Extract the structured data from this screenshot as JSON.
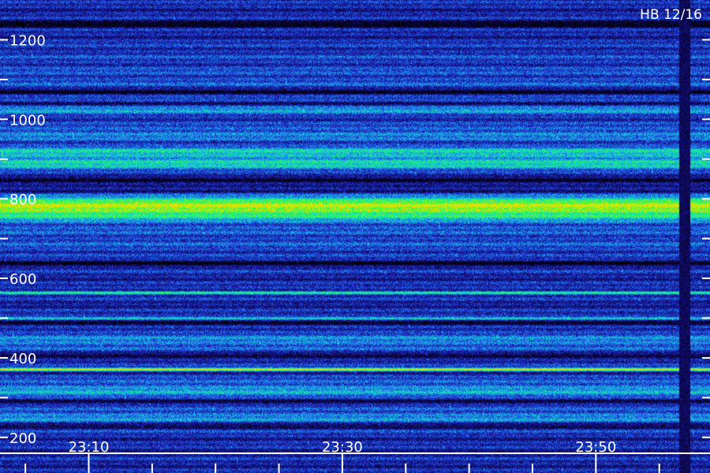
{
  "station_label": "HB 12/16",
  "chart_data": {
    "type": "heatmap",
    "title": "",
    "xlabel": "",
    "ylabel": "",
    "y_range": [
      160,
      1300
    ],
    "y_ticks_major": [
      200,
      400,
      600,
      800,
      1000,
      1200
    ],
    "y_tick_labels": [
      "200",
      "400",
      "600",
      "800",
      "1000",
      "1200"
    ],
    "y_ticks_minor": [
      300,
      500,
      700,
      900,
      1100
    ],
    "x_range": [
      "23:03",
      "23:59"
    ],
    "x_ticks_major": [
      "23:10",
      "23:30",
      "23:50"
    ],
    "x_tick_labels": [
      "23:10",
      "23:30",
      "23:50"
    ],
    "x_ticks_minor": [
      "23:05",
      "23:15",
      "23:20",
      "23:25",
      "23:35",
      "23:40",
      "23:45",
      "23:55"
    ],
    "colormap": [
      "#000000",
      "#100a6a",
      "#1e2cc8",
      "#1e8cf0",
      "#10e0c0",
      "#30ff40",
      "#e8e000"
    ],
    "bands": [
      {
        "y": 1165,
        "intensity": 0.3,
        "width": 30
      },
      {
        "y": 1100,
        "intensity": 0.35,
        "width": 40
      },
      {
        "y": 1030,
        "intensity": 0.5,
        "width": 20
      },
      {
        "y": 965,
        "intensity": 0.45,
        "width": 20
      },
      {
        "y": 920,
        "intensity": 0.55,
        "width": 15
      },
      {
        "y": 890,
        "intensity": 0.6,
        "width": 20
      },
      {
        "y": 780,
        "intensity": 0.92,
        "width": 30
      },
      {
        "y": 700,
        "intensity": 0.35,
        "width": 60
      },
      {
        "y": 565,
        "intensity": 0.75,
        "width": 4
      },
      {
        "y": 500,
        "intensity": 0.78,
        "width": 4
      },
      {
        "y": 440,
        "intensity": 0.45,
        "width": 30
      },
      {
        "y": 372,
        "intensity": 0.98,
        "width": 4
      },
      {
        "y": 320,
        "intensity": 0.5,
        "width": 25
      },
      {
        "y": 250,
        "intensity": 0.45,
        "width": 30
      }
    ],
    "dark_gaps": [
      1240,
      1070,
      1040,
      850,
      820,
      640,
      490,
      410,
      290,
      230
    ],
    "dropout": {
      "time": "23:57",
      "intensity": 0.05
    }
  }
}
